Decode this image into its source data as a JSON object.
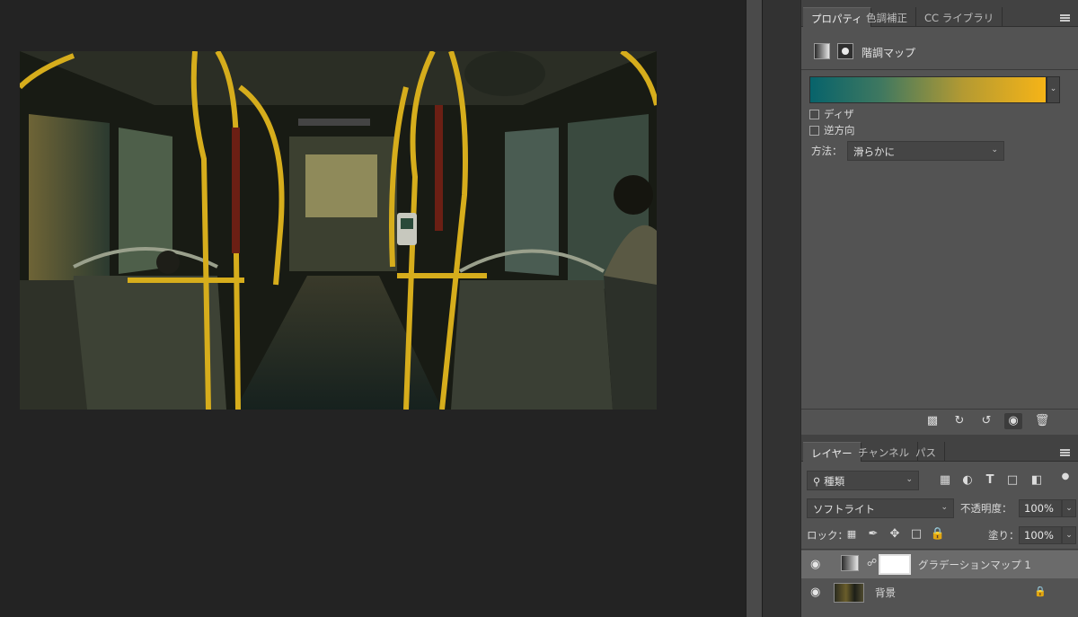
{
  "canvas": {
    "photo_alt": "bus-interior-photo"
  },
  "properties_panel": {
    "tabs": [
      "プロパティ",
      "色調補正",
      "CC ライブラリ"
    ],
    "active_tab": "プロパティ",
    "adjustment_title": "階調マップ",
    "gradient": {
      "start_color": "#07636b",
      "end_color": "#f6b417"
    },
    "dither_label": "ディザ",
    "reverse_label": "逆方向",
    "method_label": "方法：",
    "method_value": "滑らかに",
    "footer_icons": [
      "clip-to-layer-icon",
      "view-previous-state-icon",
      "reset-icon",
      "visibility-icon",
      "trash-icon"
    ]
  },
  "layers_panel": {
    "tabs": [
      "レイヤー",
      "チャンネル",
      "パス"
    ],
    "active_tab": "レイヤー",
    "filter_value": "種類",
    "filter_icons": [
      "image-filter-icon",
      "adjustment-filter-icon",
      "type-filter-icon",
      "shape-filter-icon",
      "smart-object-filter-icon"
    ],
    "blend_mode": "ソフトライト",
    "opacity_label": "不透明度：",
    "opacity_value": "100%",
    "lock_label": "ロック：",
    "fill_label": "塗り：",
    "fill_value": "100%",
    "layers": [
      {
        "name": "グラデーションマップ 1",
        "selected": true
      },
      {
        "name": "背景",
        "locked": true
      }
    ]
  }
}
